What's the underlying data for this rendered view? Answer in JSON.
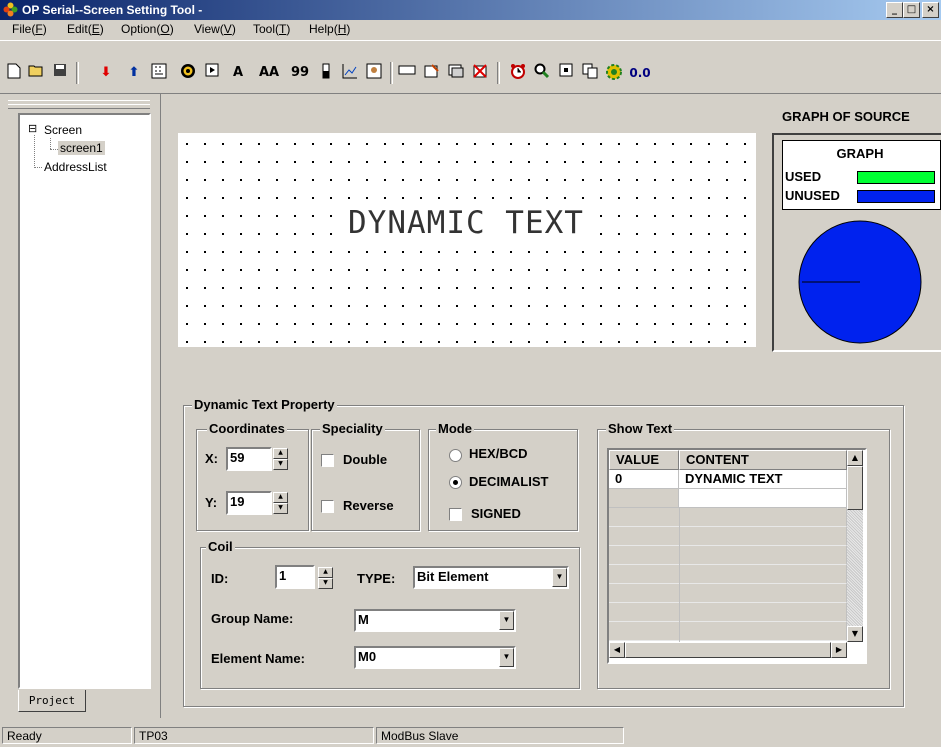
{
  "window": {
    "title": "OP Serial--Screen Setting Tool -"
  },
  "menu": [
    {
      "label": "File",
      "key": "F"
    },
    {
      "label": "Edit",
      "key": "E"
    },
    {
      "label": "Option",
      "key": "O"
    },
    {
      "label": "View",
      "key": "V"
    },
    {
      "label": "Tool",
      "key": "T"
    },
    {
      "label": "Help",
      "key": "H"
    }
  ],
  "toolbar": {
    "text_a": "A",
    "text_aa": "AA",
    "text_99": "99",
    "text_zoom": "0.0"
  },
  "tree": {
    "root": "Screen",
    "child": "screen1",
    "address": "AddressList",
    "toggle": "⊟"
  },
  "project_tab": "Project",
  "screen": {
    "dynamic_text": "DYNAMIC TEXT"
  },
  "graph": {
    "title": "GRAPH OF SOURCE",
    "heading": "GRAPH",
    "used_label": "USED",
    "unused_label": "UNUSED",
    "used_color": "#00ff33",
    "unused_color": "#0022ee"
  },
  "props": {
    "title": "Dynamic Text Property",
    "coordinates": {
      "title": "Coordinates",
      "x_label": "X:",
      "x_value": "59",
      "y_label": "Y:",
      "y_value": "19"
    },
    "speciality": {
      "title": "Speciality",
      "double": "Double",
      "reverse": "Reverse"
    },
    "mode": {
      "title": "Mode",
      "hex": "HEX/BCD",
      "decimal": "DECIMALIST",
      "signed": "SIGNED"
    },
    "coil": {
      "title": "Coil",
      "id_label": "ID:",
      "id_value": "1",
      "type_label": "TYPE:",
      "type_value": "Bit Element",
      "group_label": "Group Name:",
      "group_value": "M",
      "element_label": "Element Name:",
      "element_value": "M0"
    },
    "show_text": {
      "title": "Show Text",
      "columns": [
        "VALUE",
        "CONTENT"
      ],
      "rows": [
        [
          "0",
          "DYNAMIC TEXT"
        ]
      ]
    }
  },
  "status": {
    "left": "Ready",
    "mid": "TP03",
    "right": "ModBus Slave"
  }
}
